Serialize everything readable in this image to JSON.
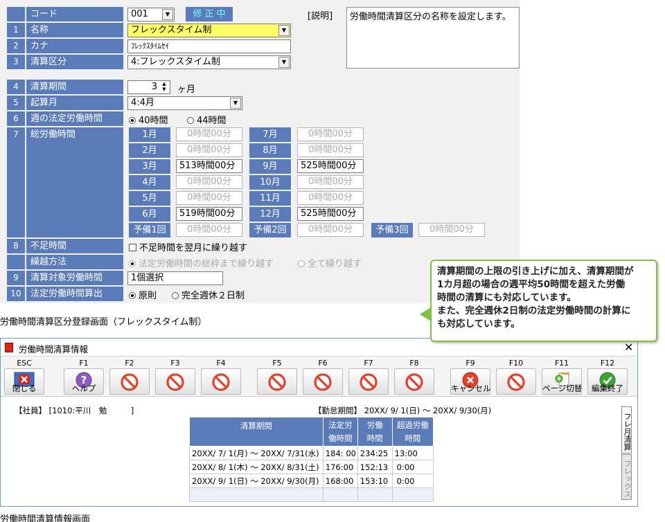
{
  "form": {
    "code_label": "コード",
    "code_value": "001",
    "mode_badge": "修 正 中",
    "desc_label": "[説明]",
    "desc_text": "労働時間清算区分の名称を設定します。",
    "rows": [
      {
        "num": "1",
        "label": "名称"
      },
      {
        "num": "2",
        "label": "カナ"
      },
      {
        "num": "3",
        "label": "清算区分"
      },
      {
        "num": "4",
        "label": "清算期間"
      },
      {
        "num": "5",
        "label": "起算月"
      },
      {
        "num": "6",
        "label": "週の法定労働時間"
      },
      {
        "num": "7",
        "label": "総労働時間"
      },
      {
        "num": "8",
        "label": "不足時間"
      },
      {
        "num": "",
        "label": "繰越方法"
      },
      {
        "num": "9",
        "label": "清算対象労働時間"
      },
      {
        "num": "10",
        "label": "法定労働時間算出"
      }
    ],
    "name_value": "フレックスタイム制",
    "kana_value": "ﾌﾚｯｸｽﾀｲﾑｾｲ",
    "settle_type_value": "4:フレックスタイム制",
    "period_value": "3",
    "period_unit": "ヶ月",
    "start_month_value": "4:4月",
    "weekly_options": [
      "40時間",
      "44時間"
    ],
    "months": [
      {
        "label": "1月",
        "value": "0時間00分",
        "enabled": false
      },
      {
        "label": "2月",
        "value": "0時間00分",
        "enabled": false
      },
      {
        "label": "3月",
        "value": "513時間00分",
        "enabled": true
      },
      {
        "label": "4月",
        "value": "0時間00分",
        "enabled": false
      },
      {
        "label": "5月",
        "value": "0時間00分",
        "enabled": false
      },
      {
        "label": "6月",
        "value": "519時間00分",
        "enabled": true
      },
      {
        "label": "7月",
        "value": "0時間00分",
        "enabled": false
      },
      {
        "label": "8月",
        "value": "0時間00分",
        "enabled": false
      },
      {
        "label": "9月",
        "value": "525時間00分",
        "enabled": true
      },
      {
        "label": "10月",
        "value": "0時間00分",
        "enabled": false
      },
      {
        "label": "11月",
        "value": "0時間00分",
        "enabled": false
      },
      {
        "label": "12月",
        "value": "525時間00分",
        "enabled": true
      }
    ],
    "spares": [
      {
        "label": "予備1回",
        "value": "0時間00分"
      },
      {
        "label": "予備2回",
        "value": "0時間00分"
      },
      {
        "label": "予備3回",
        "value": "0時間00分"
      }
    ],
    "shortage_checkbox": "不足時間を翌月に繰り越す",
    "carry_options": [
      "法定労働時間の総枠まで繰り越す",
      "全て繰り越す"
    ],
    "target_value": "1個選択",
    "calc_options": [
      "原則",
      "完全週休２日制"
    ]
  },
  "caption1": "労働時間清算区分登録画面（フレックスタイム制）",
  "callout_lines": [
    "清算期間の上限の引き上げに加え、清算期間が",
    "1カ月超の場合の週平均50時間を超えた労働",
    "時間の清算にも対応しています。",
    "また、完全週休2日制の法定労働時間の計算に",
    "も対応しています。"
  ],
  "window": {
    "title": "労働時間清算情報",
    "close_glyph": "✕",
    "fkeys": [
      {
        "key": "ESC",
        "label": "閉じる",
        "icon": "close-window-icon"
      },
      {
        "key": "F1",
        "label": "ヘルプ",
        "icon": "help-icon"
      },
      {
        "key": "F2",
        "label": "",
        "icon": "disabled-icon"
      },
      {
        "key": "F3",
        "label": "",
        "icon": "disabled-icon"
      },
      {
        "key": "F4",
        "label": "",
        "icon": "disabled-icon"
      },
      {
        "key": "F5",
        "label": "",
        "icon": "disabled-icon"
      },
      {
        "key": "F6",
        "label": "",
        "icon": "disabled-icon"
      },
      {
        "key": "F7",
        "label": "",
        "icon": "disabled-icon"
      },
      {
        "key": "F8",
        "label": "",
        "icon": "disabled-icon"
      },
      {
        "key": "F9",
        "label": "キャンセル",
        "icon": "cancel-icon"
      },
      {
        "key": "F10",
        "label": "",
        "icon": "disabled-icon"
      },
      {
        "key": "F11",
        "label": "ページ切替",
        "icon": "page-switch-icon"
      },
      {
        "key": "F12",
        "label": "編集終了",
        "icon": "check-icon"
      }
    ],
    "employee": "【社員】 [1010:平川　勉　　　]",
    "attendance_period": "【勤怠期間】 20XX/ 9/ 1(日) ～ 20XX/ 9/30(月)",
    "table": {
      "headers": [
        "清算期間",
        "法定労働時間",
        "労働時間",
        "超過労働時間"
      ],
      "header_lines": [
        [
          "清算期間"
        ],
        [
          "法定労",
          "働時間"
        ],
        [
          "労働",
          "時間"
        ],
        [
          "超過労働",
          "時間"
        ]
      ],
      "rows": [
        [
          "20XX/ 7/ 1(月) ～ 20XX/ 7/31(水)",
          "184: 00",
          "234:25",
          "13:00"
        ],
        [
          "20XX/ 8/ 1(木) ～ 20XX/ 8/31(土)",
          "176:00",
          "152:13",
          "0:00"
        ],
        [
          "20XX/ 9/ 1(日) ～ 20XX/ 9/30(月)",
          "168:00",
          "153:10",
          "0:00"
        ]
      ]
    },
    "side_tabs": [
      "フレ月清算",
      "フレックス"
    ]
  },
  "caption2": "労働時間清算情報画面"
}
